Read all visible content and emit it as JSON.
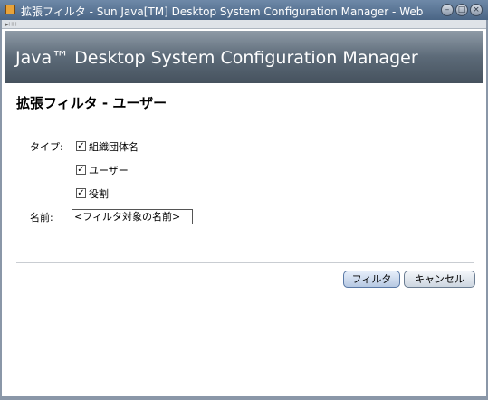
{
  "window": {
    "title": "拡張フィルタ - Sun Java[TM] Desktop System Configuration Manager - Web"
  },
  "banner": {
    "title": "Java™ Desktop System Configuration Manager"
  },
  "page": {
    "title": "拡張フィルタ - ユーザー"
  },
  "form": {
    "type_label": "タイプ:",
    "name_label": "名前:",
    "options": [
      {
        "label": "組織団体名",
        "checked": true
      },
      {
        "label": "ユーザー",
        "checked": true
      },
      {
        "label": "役割",
        "checked": true
      }
    ],
    "name_value": "<フィルタ対象の名前>",
    "check_mark": "✓"
  },
  "buttons": {
    "filter_label": "フィルタ",
    "cancel_label": "キャンセル"
  },
  "icons": {
    "minimize": "minimize-icon",
    "maximize": "maximize-icon",
    "close": "close-icon"
  },
  "colors": {
    "titlebar": "#4a6585",
    "banner": "#5c6a78",
    "primary_button": "#b6c8e2"
  }
}
